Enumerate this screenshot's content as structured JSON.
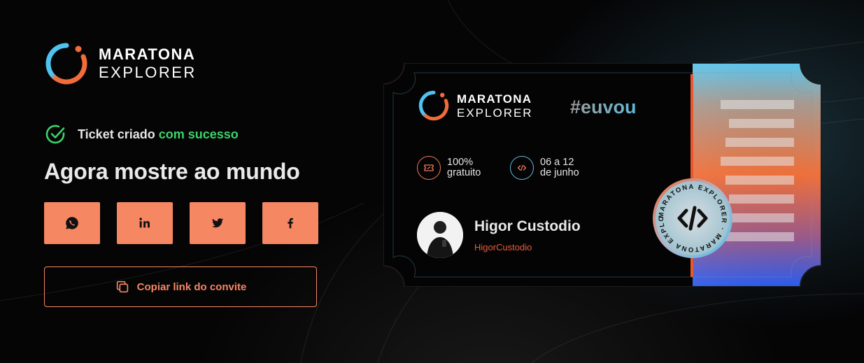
{
  "brand": {
    "line1": "MARATONA",
    "line2": "EXPLORER"
  },
  "status": {
    "prefix": "Ticket criado",
    "highlight": "com sucesso"
  },
  "headline": "Agora mostre ao mundo",
  "share": [
    {
      "network": "whatsapp",
      "icon": "whatsapp-icon"
    },
    {
      "network": "linkedin",
      "icon": "linkedin-icon"
    },
    {
      "network": "twitter",
      "icon": "twitter-icon"
    },
    {
      "network": "facebook",
      "icon": "facebook-icon"
    }
  ],
  "copy_button": {
    "label": "Copiar link do convite",
    "icon": "copy-icon"
  },
  "ticket": {
    "brand": {
      "line1": "MARATONA",
      "line2": "EXPLORER"
    },
    "hashtag": "#euvou",
    "price": {
      "line1": "100%",
      "line2": "gratuito",
      "icon": "ticket-icon"
    },
    "dates": {
      "line1": "06 a 12",
      "line2": "de junho",
      "icon": "code-icon"
    },
    "user": {
      "name": "Higor Custodio",
      "handle": "HigorCustodio"
    },
    "stamp": {
      "text": "MARATONA EXPLORER · MARATONA EXPLORER ·",
      "icon": "code-logo-icon"
    }
  },
  "colors": {
    "accent_orange": "#f58762",
    "success_green": "#3ad46a",
    "accent_blue": "#5fb9d9",
    "handle_red": "#ee5a3a"
  }
}
